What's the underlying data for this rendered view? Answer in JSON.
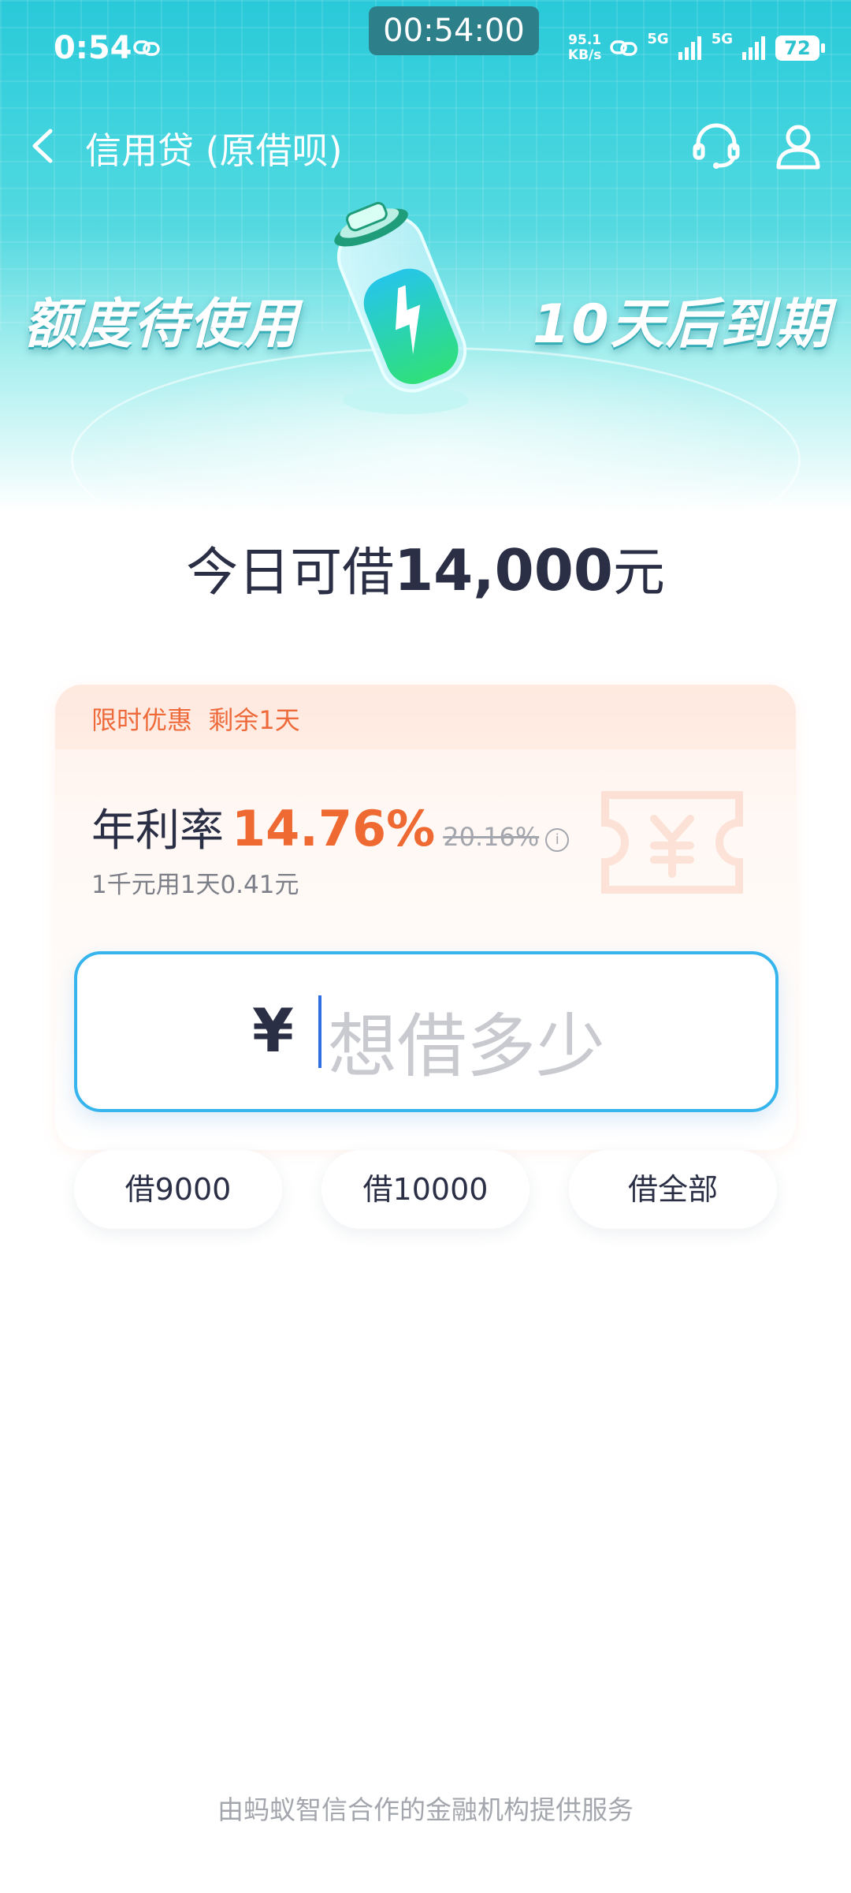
{
  "status_bar": {
    "time": "0:54",
    "timer": "00:54:00",
    "net_speed_value": "95.1",
    "net_speed_unit": "KB/s",
    "sim1": "5G",
    "sim2": "5G",
    "battery": "72"
  },
  "nav": {
    "title": "信用贷 (原借呗)"
  },
  "banner": {
    "left_text": "额度待使用",
    "right_text": "10天后到期"
  },
  "today": {
    "prefix": "今日可借",
    "amount": "14,000",
    "unit": "元"
  },
  "promo": {
    "tag": "限时优惠  剩余1天",
    "rate_label": "年利率",
    "rate_value": "14.76%",
    "rate_old": "20.16%",
    "info_icon_glyph": "i",
    "rate_desc": "1千元用1天0.41元"
  },
  "amount_input": {
    "currency": "¥",
    "placeholder": "想借多少"
  },
  "quick_buttons": [
    "借9000",
    "借10000",
    "借全部"
  ],
  "footer": "由蚂蚁智信合作的金融机构提供服务",
  "colors": {
    "accent_orange": "#ef6a33",
    "input_border": "#35b4ee",
    "hero_teal": "#29c9d9"
  }
}
